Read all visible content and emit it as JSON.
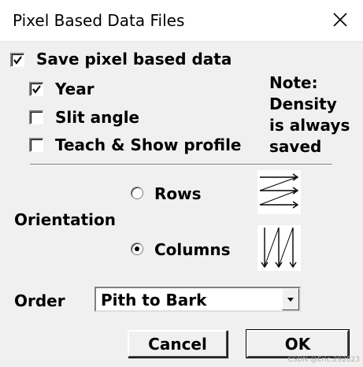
{
  "window": {
    "title": "Pixel Based Data Files",
    "close_icon": "close-icon"
  },
  "options": {
    "save_pixel": {
      "label": "Save pixel based data",
      "checked": true
    },
    "year": {
      "label": "Year",
      "checked": true
    },
    "slit_angle": {
      "label": "Slit angle",
      "checked": false
    },
    "teach_show": {
      "label": "Teach & Show profile",
      "checked": false
    }
  },
  "note": {
    "line1": "Note:",
    "line2": "Density",
    "line3": "is always",
    "line4": "saved"
  },
  "orientation": {
    "label": "Orientation",
    "rows_label": "Rows",
    "columns_label": "Columns",
    "selected": "Columns",
    "rows_icon": "rows-order-icon",
    "columns_icon": "columns-order-icon"
  },
  "order": {
    "label": "Order",
    "value": "Pith to Bark"
  },
  "buttons": {
    "cancel": "Cancel",
    "ok": "OK"
  },
  "watermark": "CSDN @Eric.292823"
}
